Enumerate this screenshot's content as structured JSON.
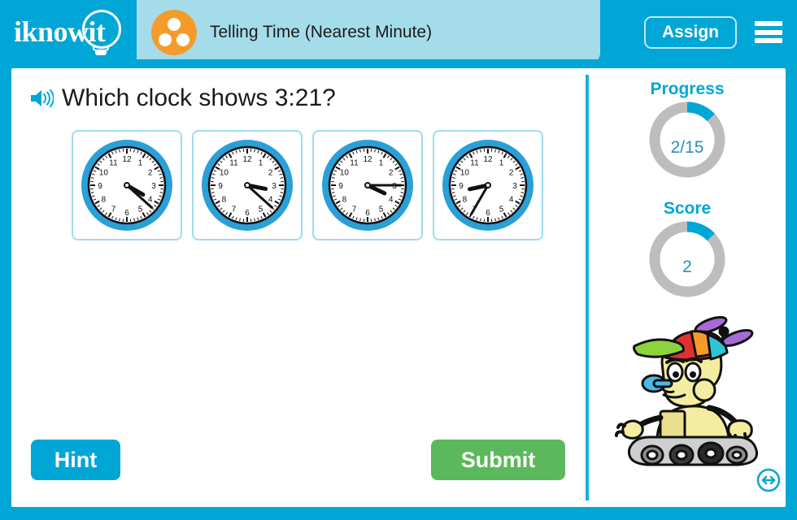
{
  "header": {
    "logo_text": "iknowit",
    "logo_icon": "lightbulb-icon",
    "topic_icon": "three-dots-circle-icon",
    "title": "Telling Time (Nearest Minute)",
    "assign_label": "Assign",
    "menu_icon": "hamburger-menu-icon",
    "bg_color": "#00a6d6",
    "title_pill_color": "#a5dcea",
    "topic_icon_color": "#f59b2a"
  },
  "question": {
    "audio_icon": "speaker-icon",
    "text": "Which clock shows 3:21?"
  },
  "answers": {
    "type": "analog-clock-choices",
    "choices": [
      {
        "id": "choice-1",
        "hour_hand": 4,
        "minute_hand": 22,
        "selected": false,
        "label": "clock option 1"
      },
      {
        "id": "choice-2",
        "hour_hand": 3.37,
        "minute_hand": 22,
        "selected": false,
        "label": "clock option 2"
      },
      {
        "id": "choice-3",
        "hour_hand": 3.85,
        "minute_hand": 15,
        "selected": false,
        "label": "clock option 3"
      },
      {
        "id": "choice-4",
        "hour_hand": 8.6,
        "minute_hand": 35,
        "selected": false,
        "label": "clock option 4"
      }
    ],
    "card_border_color": "#9fdcf0",
    "bezel_color": "#2a9fd8"
  },
  "actions": {
    "hint_label": "Hint",
    "hint_color": "#00a6d6",
    "submit_label": "Submit",
    "submit_color": "#5cb85c"
  },
  "sidebar": {
    "progress": {
      "label": "Progress",
      "value_text": "2/15",
      "current": 2,
      "total": 15,
      "percent": 13,
      "arc_color": "#00a6d6",
      "track_color": "#bdbdbd"
    },
    "score": {
      "label": "Score",
      "value_text": "2",
      "current": 2,
      "percent": 13,
      "arc_color": "#00a6d6",
      "track_color": "#bdbdbd"
    },
    "mascot": {
      "name": "robot-mascot",
      "description": "cartoon robot with propeller beanie and tank treads",
      "cap_colors": [
        "#8dd43a",
        "#e03131",
        "#f59b2a",
        "#2ec4d6"
      ],
      "propeller_color": "#a66bd4",
      "body_color": "#f4eda0",
      "whistle_color": "#4ab8e8"
    },
    "resize_icon": "resize-arrows-icon"
  }
}
